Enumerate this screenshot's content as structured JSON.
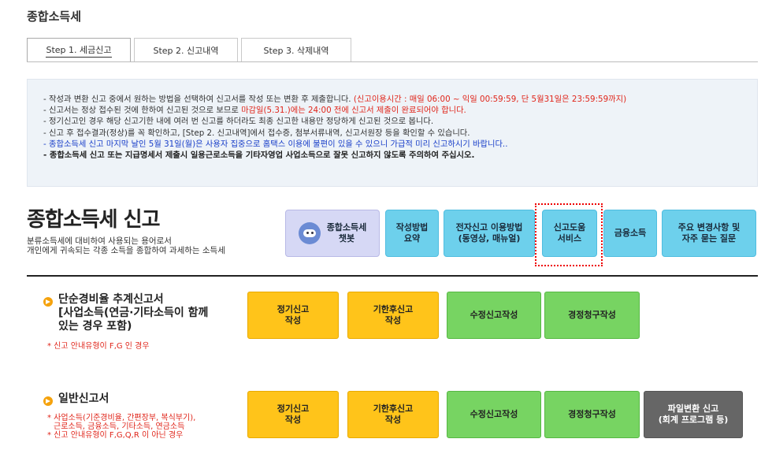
{
  "page_title": "종합소득세",
  "tabs": [
    {
      "label": "Step 1. 세금신고"
    },
    {
      "label": "Step 2. 신고내역"
    },
    {
      "label": "Step 3. 삭제내역"
    }
  ],
  "notice": {
    "line1_a": "작성과 변환 신고 중에서 원하는 방법을 선택하여 신고서를 작성 또는 변환 후 제출합니다. ",
    "line1_b": "(신고이용시간 : 매일 06:00 ~ 익일 00:59:59, 단 5월31일은 23:59:59까지)",
    "line2_a": "신고서는 정상 접수된 것에 한하여 신고된 것으로 보므로 ",
    "line2_b": "마감일(5.31.)에는 24:00 전에 신고서 제출이 완료되어야 합니다.",
    "line3": "정기신고인 경우 해당 신고기한 내에 여러 번 신고를 하더라도 최종 신고한 내용만 정당하게 신고된 것으로 봅니다.",
    "line4": "신고 후 접수결과(정상)를 꼭 확인하고, [Step 2. 신고내역]에서 접수증, 첨부서류내역, 신고서원장 등을 확인할 수 있습니다.",
    "line5": "종합소득세 신고 마지막 날인 5월 31일(월)은 사용자 집중으로 홈택스 이용에 불편이 있을 수 있으니 가급적 미리 신고하시기 바랍니다..",
    "line6": "종합소득세 신고 또는 지급명세서 제출시 일용근로소득을 기타자영업 사업소득으로 잘못 신고하지 않도록 주의하여 주십시오."
  },
  "main_title": "종합소득세 신고",
  "description": [
    "분류소득세에 대비하여 사용되는 용어로서",
    "개인에게 귀속되는 각종 소득을 종합하여 과세하는 소득세"
  ],
  "info_buttons": {
    "chatbot": [
      "종합소득세",
      "챗봇"
    ],
    "summary": [
      "작성방법",
      "요약"
    ],
    "usage": [
      "전자신고 이용방법",
      "(동영상, 매뉴얼)"
    ],
    "help": [
      "신고도움",
      "서비스"
    ],
    "finance": "금융소득",
    "faq": [
      "주요 변경사항 및",
      "자주 묻는 질문"
    ]
  },
  "section1": {
    "title": [
      "단순경비율 추계신고서",
      "[사업소득(연금·기타소득이 함께",
      "있는 경우 포함)"
    ],
    "note": "* 신고 안내유형이 F,G 인 경우",
    "buttons": {
      "regular": [
        "정기신고",
        "작성"
      ],
      "late": [
        "기한후신고",
        "작성"
      ],
      "amend": "수정신고작성",
      "correction": "경정청구작성"
    }
  },
  "section2": {
    "title": "일반신고서",
    "notes": [
      "* 사업소득(기준경비율, 간편장부, 복식부기),",
      "근로소득, 금융소득, 기타소득, 연금소득",
      "* 신고 안내유형이 F,G,Q,R 이 아닌 경우"
    ],
    "buttons": {
      "regular": [
        "정기신고",
        "작성"
      ],
      "late": [
        "기한후신고",
        "작성"
      ],
      "amend": "수정신고작성",
      "correction": "경정청구작성",
      "file_convert": [
        "파일변환 신고",
        "(회계 프로그램 등)"
      ]
    }
  },
  "colors": {
    "yellow": "#ffc41a",
    "green": "#77d462",
    "cyan": "#6dd0ec",
    "red": "#e0261b",
    "blue": "#1a3fc9"
  }
}
